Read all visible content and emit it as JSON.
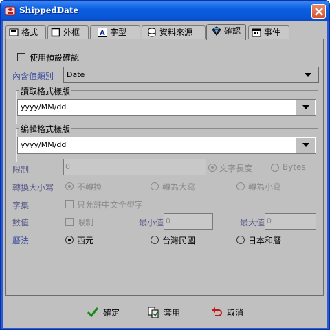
{
  "window": {
    "title": "ShippedDate"
  },
  "tabs": [
    {
      "label": "格式",
      "icon": "format-icon"
    },
    {
      "label": "外框",
      "icon": "border-icon"
    },
    {
      "label": "字型",
      "icon": "font-icon"
    },
    {
      "label": "資料來源",
      "icon": "database-icon"
    },
    {
      "label": "確認",
      "icon": "validation-icon",
      "active": true
    },
    {
      "label": "事件",
      "icon": "event-icon"
    }
  ],
  "panel": {
    "use_default_validation": {
      "label": "使用預設確認",
      "checked": false
    },
    "value_type": {
      "label": "內含值類別",
      "value": "Date"
    },
    "read_format": {
      "legend": "讀取格式樣版",
      "value": "yyyy/MM/dd"
    },
    "edit_format": {
      "legend": "編輯格式樣版",
      "value": "yyyy/MM/dd"
    },
    "limit": {
      "label": "限制",
      "value": "0",
      "opt_text_length": "文字長度",
      "opt_bytes": "Bytes"
    },
    "case_convert": {
      "label": "轉換大小寫",
      "opt_none": "不轉換",
      "opt_upper": "轉為大寫",
      "opt_lower": "轉為小寫"
    },
    "charset": {
      "label": "字集",
      "opt_fullwidth": "只允許中文全型字"
    },
    "numeric": {
      "label": "數值",
      "opt_limit": "限制",
      "min_label": "最小值",
      "min_value": "0",
      "max_label": "最大值",
      "max_value": "0"
    },
    "calendar": {
      "label": "曆法",
      "opt_western": "西元",
      "opt_roc": "台灣民國",
      "opt_japan": "日本和曆"
    }
  },
  "buttons": {
    "ok": "確定",
    "apply": "套用",
    "cancel": "取消"
  },
  "colors": {
    "accent_label": "#3f4fa0",
    "disabled": "#8a8a8a",
    "titlebar": "#0a5ee0"
  }
}
